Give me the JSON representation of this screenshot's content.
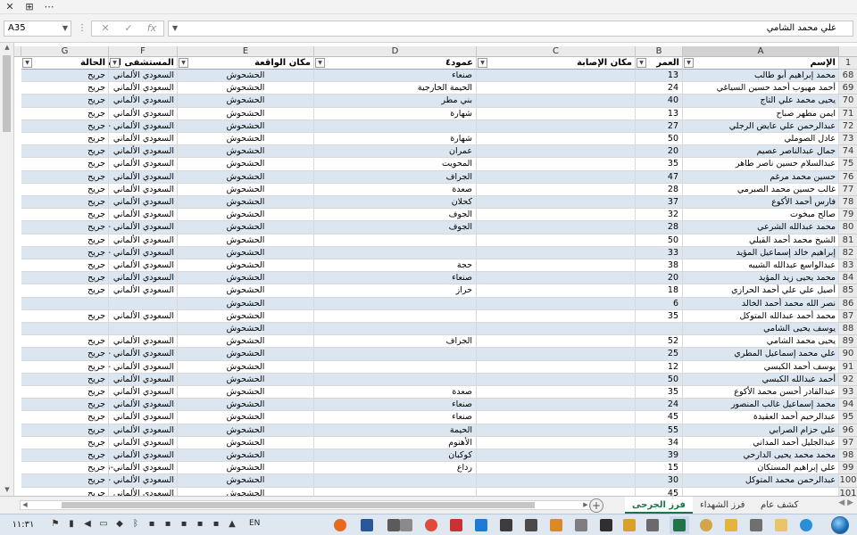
{
  "name_box": "A35",
  "formula_value": "علي محمد الشامي",
  "formula_buttons": {
    "cancel": "✕",
    "enter": "✓",
    "fx": "fx"
  },
  "colors": {
    "band": "#dce6f1",
    "active_tab": "#217346",
    "header_bg": "#eaeaea"
  },
  "columns": [
    "A",
    "B",
    "C",
    "D",
    "E",
    "F",
    "G"
  ],
  "headers": {
    "name": "الإسم",
    "age": "العمر",
    "injury": "مكان الإصابة",
    "district": "عمود٤",
    "incident": "مكان الواقعة",
    "hospital": "المستشفى اليمني",
    "status": "الحالة"
  },
  "rows": [
    {
      "n": "68",
      "name": "محمد إبراهيم أبو طالب",
      "age": "13",
      "district": "صنعاء",
      "incident": "الحشحوش",
      "hospital": "السعودي الألماني",
      "status": "جريح"
    },
    {
      "n": "69",
      "name": "أحمد مهيوب أحمد حسين السياغي",
      "age": "24",
      "district": "الحيمة الخارجية",
      "incident": "الحشحوش",
      "hospital": "السعودي الألماني",
      "status": "جريح"
    },
    {
      "n": "70",
      "name": "يحيى محمد علي التاج",
      "age": "40",
      "district": "بني مطر",
      "incident": "الحشحوش",
      "hospital": "السعودي الألماني",
      "status": "جريح"
    },
    {
      "n": "71",
      "name": "ايمن مطهر صباح",
      "age": "13",
      "district": "شهارة",
      "incident": "الحشحوش",
      "hospital": "السعودي الألماني",
      "status": "جريح"
    },
    {
      "n": "72",
      "name": "عبدالرحمن علي عايض الرجلي",
      "age": "27",
      "district": "",
      "incident": "الحشحوش",
      "hospital": "السعودي الألماني - نقل",
      "status": "جريح"
    },
    {
      "n": "73",
      "name": "عادل الصوملي",
      "age": "50",
      "district": "شهارة",
      "incident": "الحشحوش",
      "hospital": "السعودي الألماني",
      "status": "جريح"
    },
    {
      "n": "74",
      "name": "جمال عبدالناصر عصيم",
      "age": "20",
      "district": "عمران",
      "incident": "الحشحوش",
      "hospital": "السعودي الألماني",
      "status": "جريح"
    },
    {
      "n": "75",
      "name": "عبدالسلام حسين ناصر طاهر",
      "age": "35",
      "district": "المحويت",
      "incident": "الحشحوش",
      "hospital": "السعودي الألماني",
      "status": "جريح"
    },
    {
      "n": "76",
      "name": "حسين محمد مرغم",
      "age": "47",
      "district": "الجراف",
      "incident": "الحشحوش",
      "hospital": "السعودي الألماني",
      "status": "جريح"
    },
    {
      "n": "77",
      "name": "غالب حسين محمد الصبرمي",
      "age": "28",
      "district": "صعدة",
      "incident": "الحشحوش",
      "hospital": "السعودي الألماني",
      "status": "جريح"
    },
    {
      "n": "78",
      "name": "فارس أحمد الأكوع",
      "age": "37",
      "district": "كحلان",
      "incident": "الحشحوش",
      "hospital": "السعودي الألماني",
      "status": "جريح"
    },
    {
      "n": "79",
      "name": "صالح مبخوت",
      "age": "32",
      "district": "الجوف",
      "incident": "الحشحوش",
      "hospital": "السعودي الألماني",
      "status": "جريح"
    },
    {
      "n": "80",
      "name": "محمد عبدالله الشرعي",
      "age": "28",
      "district": "الجوف",
      "incident": "الحشحوش",
      "hospital": "السعودي الألماني - نقل",
      "status": "جريح"
    },
    {
      "n": "81",
      "name": "الشيخ محمد أحمد القبلي",
      "age": "50",
      "district": "",
      "incident": "الحشحوش",
      "hospital": "السعودي الألماني",
      "status": "جريح"
    },
    {
      "n": "82",
      "name": "إبراهيم خالد إسماعيل المؤيد",
      "age": "33",
      "district": "",
      "incident": "الحشحوش",
      "hospital": "السعودي الألماني - نقل",
      "status": "جريح"
    },
    {
      "n": "83",
      "name": "عبدالواسع عبدالله الشيبه",
      "age": "38",
      "district": "حجة",
      "incident": "الحشحوش",
      "hospital": "السعودي الألماني",
      "status": "جريح"
    },
    {
      "n": "84",
      "name": "محمد يحيى زيد المؤيد",
      "age": "20",
      "district": "صنعاء",
      "incident": "الحشحوش",
      "hospital": "السعودي الألماني",
      "status": "جريح"
    },
    {
      "n": "85",
      "name": "أصيل علي علي أحمد الحرازي",
      "age": "18",
      "district": "حراز",
      "incident": "الحشحوش",
      "hospital": "السعودي الألماني",
      "status": "جريح"
    },
    {
      "n": "86",
      "name": "نصر الله محمد أحمد الخالد",
      "age": "6",
      "district": "",
      "incident": "الحشحوش",
      "hospital": "",
      "status": ""
    },
    {
      "n": "87",
      "name": "محمد أحمد عبدالله المتوكل",
      "age": "35",
      "district": "",
      "incident": "الحشحوش",
      "hospital": "السعودي الألماني",
      "status": "جريح"
    },
    {
      "n": "88",
      "name": "يوسف يحيى الشامي",
      "age": "",
      "district": "",
      "incident": "الحشحوش",
      "hospital": "",
      "status": ""
    },
    {
      "n": "89",
      "name": "يحيى محمد الشامي",
      "age": "52",
      "district": "الجراف",
      "incident": "الحشحوش",
      "hospital": "السعودي الألماني",
      "status": "جريح"
    },
    {
      "n": "90",
      "name": "علي محمد إسماعيل المطري",
      "age": "25",
      "district": "",
      "incident": "الحشحوش",
      "hospital": "السعودي الألماني - نقل",
      "status": "جريح"
    },
    {
      "n": "91",
      "name": "يوسف أحمد الكبسي",
      "age": "12",
      "district": "",
      "incident": "الحشحوش",
      "hospital": "السعودي الألماني - نقل",
      "status": "جريح"
    },
    {
      "n": "92",
      "name": "أحمد عبدالله الكبسي",
      "age": "50",
      "district": "",
      "incident": "الحشحوش",
      "hospital": "السعودي الألماني",
      "status": "جريح"
    },
    {
      "n": "93",
      "name": "عبدالقادر أحسن محمد الأكوع",
      "age": "35",
      "district": "صعدة",
      "incident": "الحشحوش",
      "hospital": "السعودي الألماني",
      "status": "جريح"
    },
    {
      "n": "94",
      "name": "محمد إسماعيل غالب المنصور",
      "age": "24",
      "district": "صنعاء",
      "incident": "الحشحوش",
      "hospital": "السعودي الألماني",
      "status": "جريح"
    },
    {
      "n": "95",
      "name": "عبدالرحيم أحمد العقيدة",
      "age": "45",
      "district": "صنعاء",
      "incident": "الحشحوش",
      "hospital": "السعودي الألماني",
      "status": "جريح"
    },
    {
      "n": "96",
      "name": "علي حزام الصرابي",
      "age": "55",
      "district": "الحيمة",
      "incident": "الحشحوش",
      "hospital": "السعودي الألماني",
      "status": "جريح"
    },
    {
      "n": "97",
      "name": "عبدالجليل أحمد المداني",
      "age": "34",
      "district": "الأهنوم",
      "incident": "الحشحوش",
      "hospital": "السعودي الألماني",
      "status": "جريح"
    },
    {
      "n": "98",
      "name": "محمد محمد يحيى الدارحي",
      "age": "39",
      "district": "كوكبان",
      "incident": "الحشحوش",
      "hospital": "السعودي الألماني",
      "status": "جريح"
    },
    {
      "n": "99",
      "name": "علي إبراهيم المستكان",
      "age": "15",
      "district": "رداع",
      "incident": "الحشحوش",
      "hospital": "السعودي الألماني-نقل",
      "status": "جريح"
    },
    {
      "n": "100",
      "name": "عبدالرحمن محمد المتوكل",
      "age": "30",
      "district": "",
      "incident": "الحشحوش",
      "hospital": "السعودي الألماني - نقل",
      "status": "جريح"
    },
    {
      "n": "101",
      "name": "",
      "age": "45",
      "district": "",
      "incident": "الحشحوش",
      "hospital": "السعودي الألماني",
      "status": "جريح"
    }
  ],
  "sheet_tabs": [
    "كشف عام",
    "فرز الشهداء",
    "فرز الجرحى"
  ],
  "active_tab_index": 2,
  "taskbar": {
    "clock": "١١:٣١",
    "language": "EN"
  }
}
